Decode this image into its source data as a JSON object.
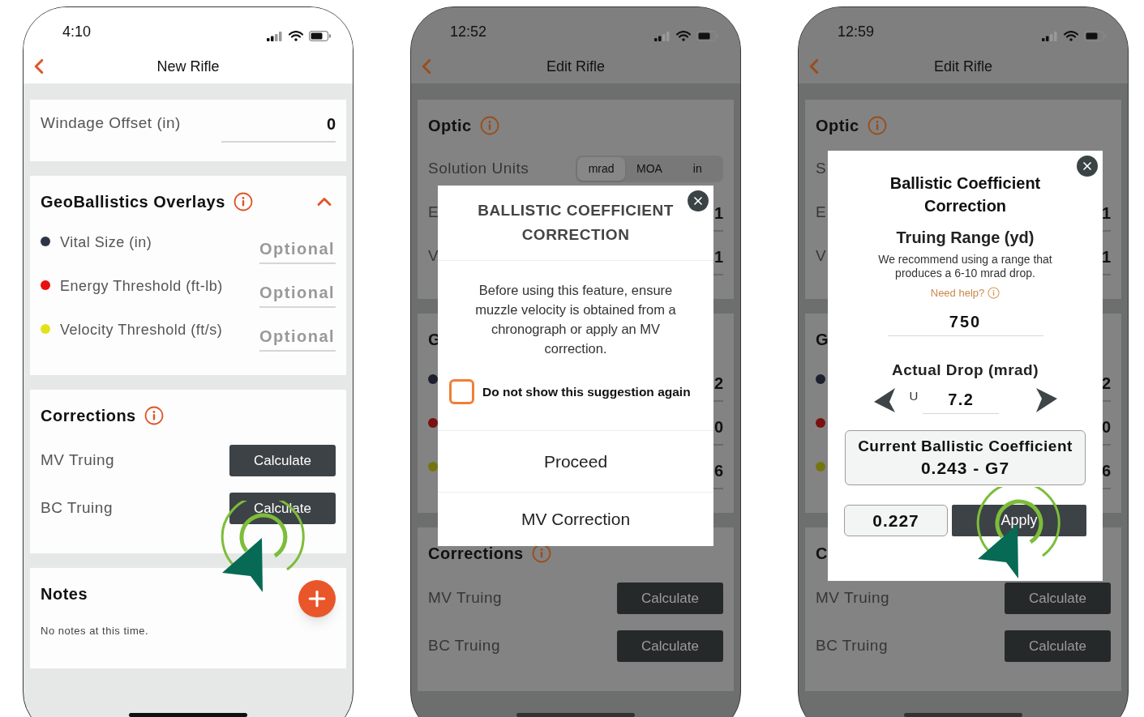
{
  "phones": [
    {
      "dimmed": false,
      "status": {
        "time": "4:10"
      },
      "nav": {
        "title": "New Rifle"
      },
      "cards": [
        {
          "rows": [
            {
              "kind": "field",
              "label": "Windage Offset (in)",
              "value": "0"
            }
          ]
        },
        {
          "title": "GeoBallistics Overlays",
          "info": true,
          "expanded": true,
          "rows": [
            {
              "kind": "dot_field",
              "color": "#2d3446",
              "label": "Vital Size (in)",
              "placeholder": "Optional"
            },
            {
              "kind": "dot_field",
              "color": "#e81010",
              "label": "Energy Threshold (ft-lb)",
              "placeholder": "Optional"
            },
            {
              "kind": "dot_field",
              "color": "#e2e21a",
              "label": "Velocity Threshold (ft/s)",
              "placeholder": "Optional"
            }
          ]
        },
        {
          "title": "Corrections",
          "info": true,
          "rows": [
            {
              "kind": "button",
              "label": "MV Truing",
              "button": "Calculate",
              "tapped": false
            },
            {
              "kind": "button",
              "label": "BC Truing",
              "button": "Calculate",
              "tapped": true
            }
          ]
        },
        {
          "title": "Notes",
          "add_button": true,
          "rows": [
            {
              "kind": "note",
              "text": "No notes at this time."
            }
          ]
        }
      ]
    },
    {
      "dimmed": true,
      "status": {
        "time": "12:52"
      },
      "nav": {
        "title": "Edit Rifle"
      },
      "cards": [
        {
          "title": "Optic",
          "info": true,
          "rows": [
            {
              "kind": "segmented",
              "label": "Solution Units",
              "options": [
                {
                  "label": "mrad",
                  "selected": true
                },
                {
                  "label": "MOA",
                  "selected": false
                },
                {
                  "label": "in",
                  "selected": false
                }
              ]
            },
            {
              "kind": "field",
              "label": "E",
              "value": "1"
            },
            {
              "kind": "field",
              "label": "V",
              "value": "1"
            }
          ]
        },
        {
          "title": "G",
          "rows": [
            {
              "kind": "dot_field",
              "color": "#1c2030",
              "value": "2"
            },
            {
              "kind": "dot_field",
              "color": "#7a1010",
              "value": "0"
            },
            {
              "kind": "dot_field",
              "color": "#75750f",
              "value": "6"
            }
          ]
        },
        {
          "title": "Corrections",
          "info": true,
          "rows": [
            {
              "kind": "button",
              "label": "MV Truing",
              "button": "Calculate",
              "tapped": false
            },
            {
              "kind": "button",
              "label": "BC Truing",
              "button": "Calculate",
              "tapped": false
            }
          ]
        }
      ],
      "modal": {
        "kind": "notice",
        "title": "BALLISTIC COEFFICIENT CORRECTION",
        "body": "Before using this feature, ensure muzzle velocity is obtained from a chronograph or apply an MV correction.",
        "checkbox": {
          "label": "Do not show this suggestion again",
          "checked": false
        },
        "actions": [
          "Proceed",
          "MV Correction"
        ]
      }
    },
    {
      "dimmed": true,
      "status": {
        "time": "12:59"
      },
      "nav": {
        "title": "Edit Rifle"
      },
      "cards": [
        {
          "title": "Optic",
          "info": true,
          "rows": [
            {
              "kind": "field",
              "label": "S"
            },
            {
              "kind": "field",
              "label": "E",
              "value": "1"
            },
            {
              "kind": "field",
              "label": "V",
              "value": "1"
            }
          ]
        },
        {
          "title": "G",
          "rows": [
            {
              "kind": "dot_field",
              "color": "#1c2030",
              "value": "2"
            },
            {
              "kind": "dot_field",
              "color": "#7a1010",
              "value": "0"
            },
            {
              "kind": "dot_field",
              "color": "#75750f",
              "value": "6"
            }
          ]
        },
        {
          "title": "C",
          "rows": [
            {
              "kind": "button",
              "label": "MV Truing",
              "button": "Calculate",
              "tapped": false
            },
            {
              "kind": "button",
              "label": "BC Truing",
              "button": "Calculate",
              "tapped": false
            }
          ]
        }
      ],
      "modal": {
        "kind": "truing",
        "title": "Ballistic Coefficient Correction",
        "range_label": "Truing Range (yd)",
        "hint": "We recommend using a range that produces a 6-10 mrad drop.",
        "help": "Need help?",
        "range_value": "750",
        "drop_label": "Actual Drop (mrad)",
        "drop_unit": "U",
        "drop_value": "7.2",
        "current_label": "Current Ballistic Coefficient",
        "current_value": "0.243 - G7",
        "new_value": "0.227",
        "apply": {
          "label": "Apply",
          "tapped": true
        }
      }
    }
  ]
}
